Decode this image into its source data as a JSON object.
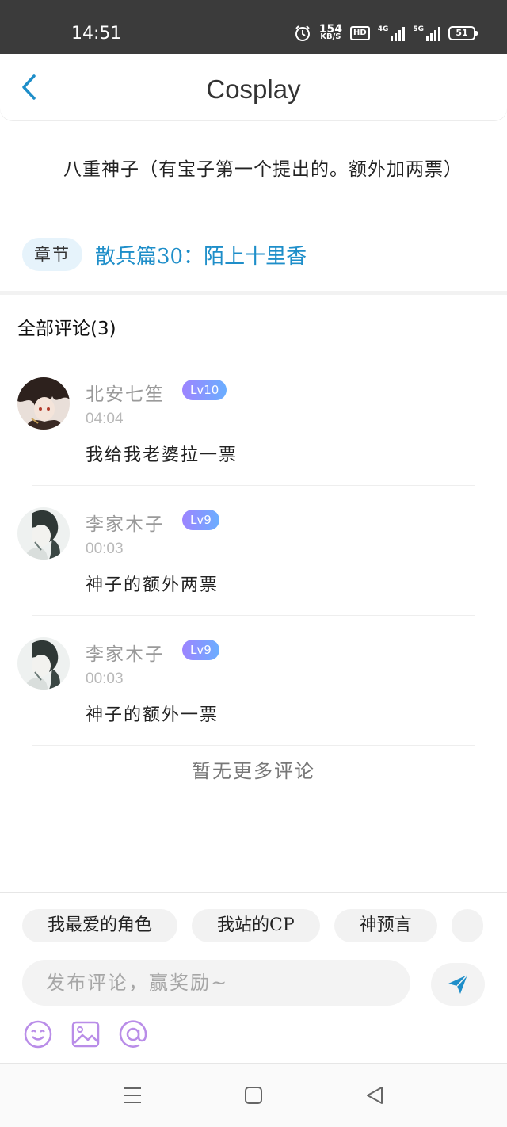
{
  "status": {
    "time": "14:51",
    "net_speed": "154",
    "net_unit": "KB/S",
    "hd": "HD",
    "sig1": "4G",
    "sig2": "5G",
    "battery": "51"
  },
  "header": {
    "title": "Cosplay",
    "back_icon": "chevron-left-icon"
  },
  "topic": {
    "text": "八重神子（有宝子第一个提出的。额外加两票）",
    "chapter_tag": "章节",
    "chapter_link": "散兵篇30：陌上十里香"
  },
  "comments": {
    "heading": "全部评论(3)",
    "items": [
      {
        "user": "北安七笙",
        "level": "Lv10",
        "time": "04:04",
        "text": "我给我老婆拉一票"
      },
      {
        "user": "李家木子",
        "level": "Lv9",
        "time": "00:03",
        "text": "神子的额外两票"
      },
      {
        "user": "李家木子",
        "level": "Lv9",
        "time": "00:03",
        "text": "神子的额外一票"
      }
    ],
    "no_more": "暂无更多评论"
  },
  "composer": {
    "chips": [
      "我最爱的角色",
      "我站的CP",
      "神预言"
    ],
    "placeholder": "发布评论，赢奖励~",
    "send_icon": "send-icon",
    "tools": [
      "emoji-icon",
      "image-icon",
      "mention-icon"
    ]
  },
  "colors": {
    "accent": "#1e8ec9",
    "level_badge": "#8f94ff",
    "tool_icon": "#b98de8"
  }
}
